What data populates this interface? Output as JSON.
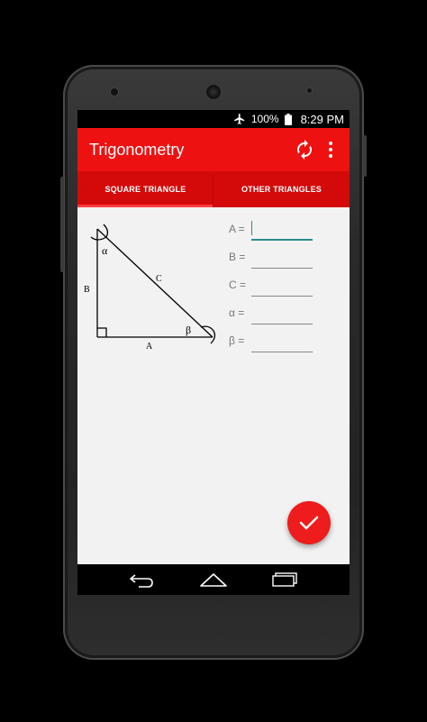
{
  "status_bar": {
    "battery": "100%",
    "time": "8:29 PM",
    "icons": [
      "airplane-icon",
      "battery-icon"
    ]
  },
  "app_bar": {
    "title": "Trigonometry",
    "icons": [
      "refresh-icon",
      "more-vert-icon"
    ]
  },
  "tabs": [
    {
      "label": "SQUARE TRIANGLE",
      "selected": true
    },
    {
      "label": "OTHER TRIANGLES",
      "selected": false
    }
  ],
  "diagram": {
    "alpha": "α",
    "beta": "β",
    "a": "A",
    "b": "B",
    "c": "C"
  },
  "fields": [
    {
      "label": "A =",
      "value": ""
    },
    {
      "label": "B =",
      "value": ""
    },
    {
      "label": "C =",
      "value": ""
    },
    {
      "label": "α =",
      "value": ""
    },
    {
      "label": "β =",
      "value": ""
    }
  ],
  "fab": {
    "icon": "check-icon"
  },
  "nav_bar": {
    "icons": [
      "back-icon",
      "home-icon",
      "recents-icon"
    ]
  },
  "colors": {
    "primary": "#ee1111",
    "tab_bar": "#d40a0a",
    "accent": "#2a8c8c",
    "fab": "#ee1c1c"
  }
}
